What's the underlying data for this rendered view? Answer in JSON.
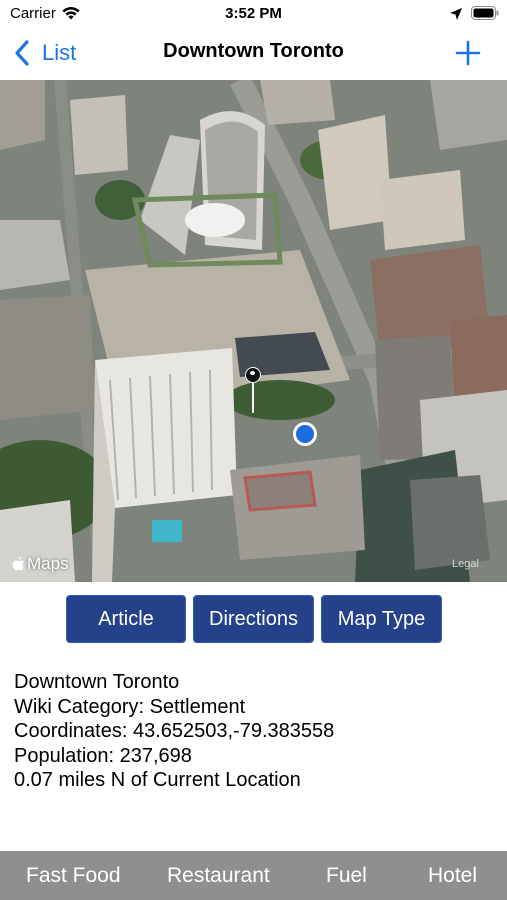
{
  "status_bar": {
    "carrier": "Carrier",
    "time": "3:52 PM",
    "icons": [
      "wifi-icon",
      "location-arrow-icon",
      "battery-icon"
    ]
  },
  "nav": {
    "back_label": "List",
    "title": "Downtown Toronto",
    "add_icon": "plus-icon"
  },
  "map": {
    "attribution": "Maps",
    "legal": "Legal",
    "pin_icon": "map-pin-icon",
    "user_location_icon": "user-location-icon"
  },
  "actions": {
    "article": "Article",
    "directions": "Directions",
    "map_type": "Map Type"
  },
  "info": {
    "name": "Downtown Toronto",
    "category": "Wiki Category: Settlement",
    "coordinates": "Coordinates: 43.652503,-79.383558",
    "population": "Population: 237,698",
    "distance": "0.07 miles N of Current Location"
  },
  "tabs": [
    "Fast Food",
    "Restaurant",
    "Fuel",
    "Hotel"
  ],
  "colors": {
    "accent": "#1a73e8",
    "button_bg": "#25418a",
    "tab_bar_bg": "#8f8f8f",
    "user_location": "#1e6be0"
  }
}
